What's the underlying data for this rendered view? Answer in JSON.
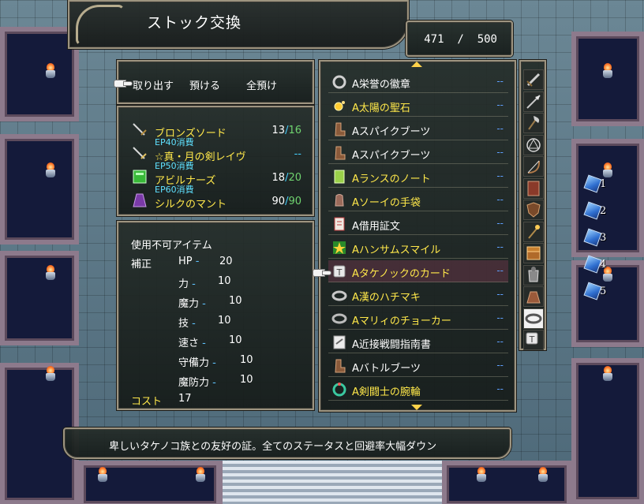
{
  "title": "ストック交換",
  "capacity": {
    "current": "471",
    "max": "500"
  },
  "commands": [
    {
      "label": "取り出す"
    },
    {
      "label": "預ける"
    },
    {
      "label": "全預け"
    }
  ],
  "skills": [
    {
      "name": "ブロンズソード",
      "ep": "EP40消費",
      "current": "13",
      "max": "16",
      "icon": "sword-icon"
    },
    {
      "name": "☆真・月の剣レイヴ",
      "ep": "EP50消費",
      "current": "--",
      "max": "",
      "icon": "sword-icon"
    },
    {
      "name": "アビルナーズ",
      "ep": "EP60消費",
      "current": "18",
      "max": "20",
      "icon": "book-icon"
    },
    {
      "name": "シルクのマント",
      "ep": "",
      "current": "90",
      "max": "90",
      "icon": "cloak-icon"
    }
  ],
  "status": {
    "header": "使用不可アイテム",
    "correction_label": "補正",
    "stats": [
      {
        "label": "HP",
        "value": "20"
      },
      {
        "label": "力",
        "value": "10"
      },
      {
        "label": "魔力",
        "value": "10"
      },
      {
        "label": "技",
        "value": "10"
      },
      {
        "label": "速さ",
        "value": "10"
      },
      {
        "label": "守備力",
        "value": "10"
      },
      {
        "label": "魔防力",
        "value": "10"
      }
    ],
    "cost_label": "コスト",
    "cost_value": "17"
  },
  "items": [
    {
      "name": "A栄誉の徽章",
      "qty": "--",
      "highlight": false,
      "icon": "badge-icon"
    },
    {
      "name": "A太陽の聖石",
      "qty": "--",
      "highlight": true,
      "icon": "sunstone-icon"
    },
    {
      "name": "Aスパイクブーツ",
      "qty": "--",
      "highlight": false,
      "icon": "boots-icon"
    },
    {
      "name": "Aスパイクブーツ",
      "qty": "--",
      "highlight": false,
      "icon": "boots-icon"
    },
    {
      "name": "Aランスのノート",
      "qty": "--",
      "highlight": true,
      "icon": "notebook-icon"
    },
    {
      "name": "Aソーイの手袋",
      "qty": "--",
      "highlight": true,
      "icon": "glove-icon"
    },
    {
      "name": "A借用証文",
      "qty": "--",
      "highlight": false,
      "icon": "document-icon"
    },
    {
      "name": "Aハンサムスマイル",
      "qty": "--",
      "highlight": true,
      "icon": "smile-icon"
    },
    {
      "name": "Aタケノックのカード",
      "qty": "--",
      "highlight": true,
      "icon": "card-icon"
    },
    {
      "name": "A漢のハチマキ",
      "qty": "--",
      "highlight": true,
      "icon": "headband-icon"
    },
    {
      "name": "Aマリィのチョーカー",
      "qty": "--",
      "highlight": true,
      "icon": "choker-icon"
    },
    {
      "name": "A近接戦闘指南書",
      "qty": "--",
      "highlight": false,
      "icon": "manual-icon"
    },
    {
      "name": "Aバトルブーツ",
      "qty": "--",
      "highlight": false,
      "icon": "boots-icon"
    },
    {
      "name": "A剣闘士の腕輪",
      "qty": "--",
      "highlight": true,
      "icon": "bracelet-icon"
    }
  ],
  "selected_item_index": 8,
  "categories": [
    "sword-icon",
    "spear-icon",
    "axe-icon",
    "magic-circle-icon",
    "bow-icon",
    "tome-icon",
    "shield-icon",
    "staff-icon",
    "chest-icon",
    "armor-icon",
    "bag-icon",
    "accessory-icon",
    "card-icon"
  ],
  "selected_category_index": 11,
  "help_text": "卑しいタケノコ族との友好の証。全てのステータスと回避率大幅ダウン",
  "map_labels": [
    "1",
    "2",
    "3",
    "4",
    "5"
  ],
  "colors": {
    "highlight_text": "#ffe84a",
    "ep_text": "#5fe1ff",
    "frame": "#9d9480",
    "selected_row": "#8c3c5a"
  }
}
